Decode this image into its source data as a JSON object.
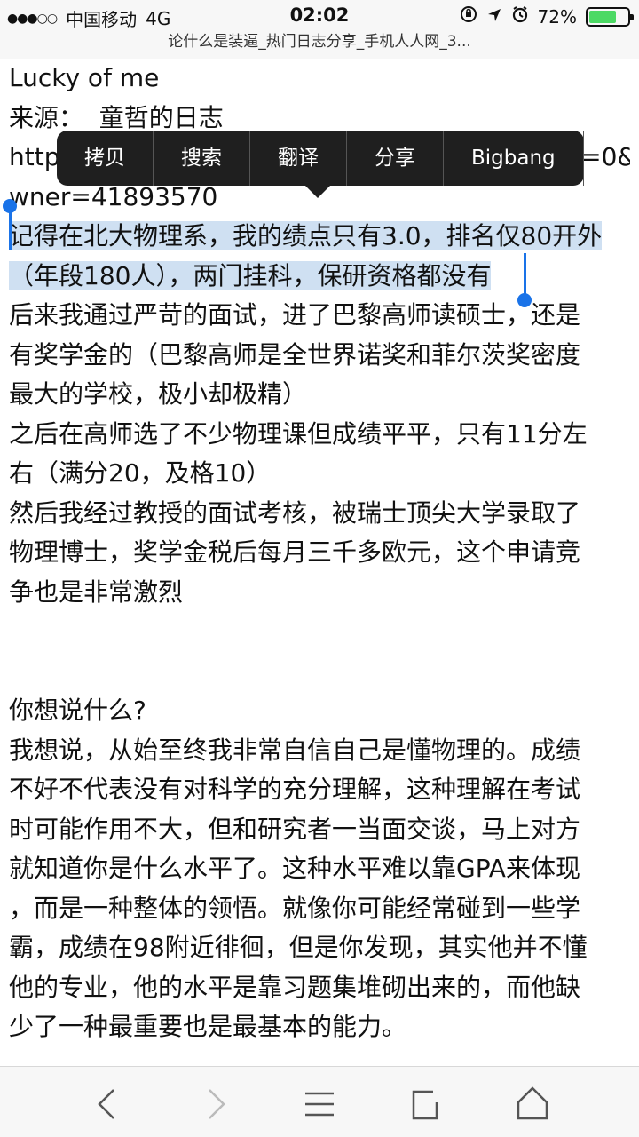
{
  "status": {
    "carrier": "中国移动",
    "network": "4G",
    "time": "02:02",
    "battery": "72%",
    "battery_level": 0.72,
    "signal_dots": "●●●○○"
  },
  "page_title": "论什么是装逼_热门日志分享_手机人人网_3...",
  "callout_menu": [
    "拷贝",
    "搜索",
    "翻译",
    "分享",
    "Bigbang"
  ],
  "content": {
    "lines": [
      {
        "text": "Lucky of me"
      },
      {
        "text": "来源：  童哲的日志"
      },
      {
        "text": "http://share.renren.com/share/GetShare.do?id=0&o"
      },
      {
        "text": "wner=41893570"
      },
      {
        "text": "记得在北大物理系，我的绩点只有3.0，排名仅80开外",
        "selected": true
      },
      {
        "text": "（年段180人），两门挂科，保研资格都没有",
        "selected": true
      },
      {
        "text": "后来我通过严苛的面试，进了巴黎高师读硕士，还是"
      },
      {
        "text": "有奖学金的（巴黎高师是全世界诺奖和菲尔茨奖密度"
      },
      {
        "text": "最大的学校，极小却极精）"
      },
      {
        "text": "之后在高师选了不少物理课但成绩平平，只有11分左"
      },
      {
        "text": "右（满分20，及格10）"
      },
      {
        "text": "然后我经过教授的面试考核，被瑞士顶尖大学录取了"
      },
      {
        "text": "物理博士，奖学金税后每月三千多欧元，这个申请竞"
      },
      {
        "text": "争也是非常激烈"
      },
      {
        "text": ""
      },
      {
        "text": ""
      },
      {
        "text": "你想说什么?"
      },
      {
        "text": "我想说，从始至终我非常自信自己是懂物理的。成绩"
      },
      {
        "text": "不好不代表没有对科学的充分理解，这种理解在考试"
      },
      {
        "text": "时可能作用不大，但和研究者一当面交谈，马上对方"
      },
      {
        "text": "就知道你是什么水平了。这种水平难以靠GPA来体现"
      },
      {
        "text": "，而是一种整体的领悟。就像你可能经常碰到一些学"
      },
      {
        "text": "霸，成绩在98附近徘徊，但是你发现，其实他并不懂"
      },
      {
        "text": "他的专业，他的水平是靠习题集堆砌出来的，而他缺"
      },
      {
        "text": "少了一种最重要也是最基本的能力。"
      }
    ]
  },
  "toolbar": {
    "icons": [
      "back-icon",
      "forward-icon",
      "menu-icon",
      "tabs-icon",
      "home-icon"
    ]
  }
}
